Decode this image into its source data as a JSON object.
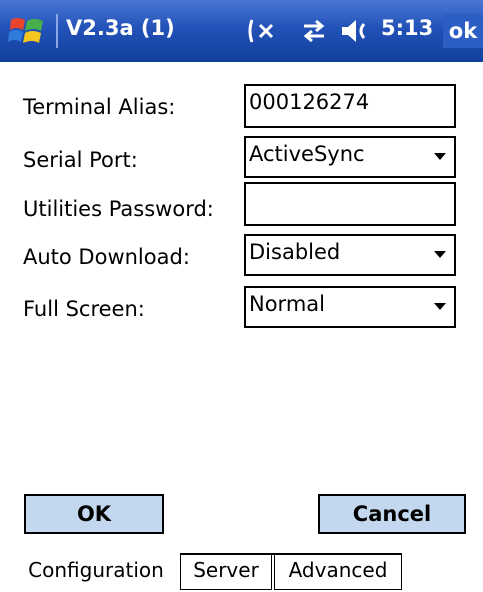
{
  "titlebar": {
    "title": "V2.3a (1)",
    "time": "5:13",
    "ok_label": "ok",
    "icons": [
      "windows-start-icon",
      "no-signal-icon",
      "sync-icon",
      "speaker-icon"
    ]
  },
  "form": {
    "terminal_alias": {
      "label": "Terminal Alias:",
      "value": "000126274"
    },
    "serial_port": {
      "label": "Serial Port:",
      "value": "ActiveSync"
    },
    "utilities_password": {
      "label": "Utilities Password:",
      "value": ""
    },
    "auto_download": {
      "label": "Auto Download:",
      "value": "Disabled"
    },
    "full_screen": {
      "label": "Full Screen:",
      "value": "Normal"
    }
  },
  "buttons": {
    "ok": "OK",
    "cancel": "Cancel"
  },
  "tabs": [
    "Configuration",
    "Server",
    "Advanced"
  ],
  "colors": {
    "titlebar": "#2352b8",
    "button_face": "#c3d7ee",
    "background": "#ffffff"
  }
}
